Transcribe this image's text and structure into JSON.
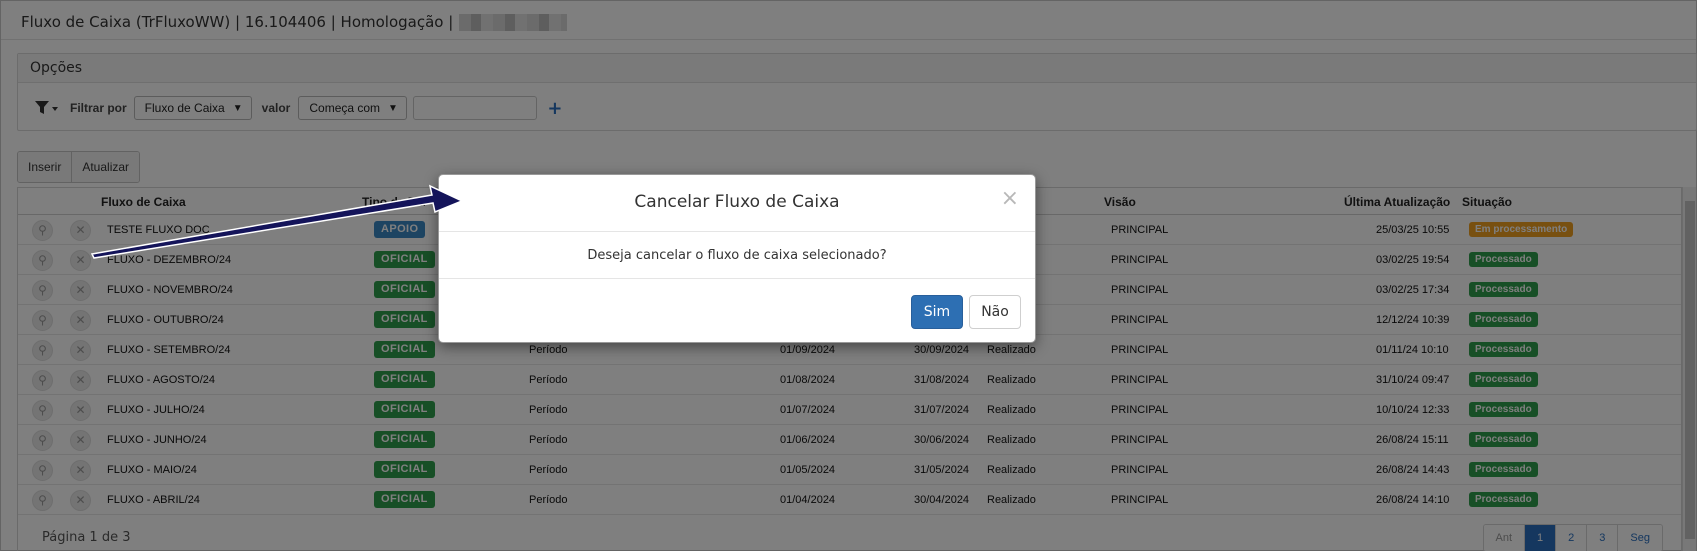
{
  "window": {
    "title": "Fluxo de Caixa (TrFluxoWW) | 16.104406 | Homologação |"
  },
  "options": {
    "header": "Opções",
    "filter_label": "Filtrar por",
    "filter_field": "Fluxo de Caixa",
    "value_label": "valor",
    "value_operator": "Começa com",
    "value_input": "",
    "add_icon": "plus-icon"
  },
  "toolbar": {
    "insert_label": "Inserir",
    "refresh_label": "Atualizar"
  },
  "grid": {
    "columns": {
      "fluxo": "Fluxo de Caixa",
      "tipo": "Tipo de Flu",
      "visao": "Visão",
      "ultima": "Última Atualização",
      "situacao": "Situação"
    },
    "rows": [
      {
        "name": "TESTE FLUXO DOC",
        "tipo": "APOIO",
        "periodo": "",
        "inicio": "",
        "fim": "",
        "realizado": "",
        "visao": "PRINCIPAL",
        "ultima": "25/03/25 10:55",
        "situacao": "Em processamento"
      },
      {
        "name": "FLUXO - DEZEMBRO/24",
        "tipo": "OFICIAL",
        "periodo": "",
        "inicio": "",
        "fim": "",
        "realizado": "",
        "visao": "PRINCIPAL",
        "ultima": "03/02/25 19:54",
        "situacao": "Processado"
      },
      {
        "name": "FLUXO - NOVEMBRO/24",
        "tipo": "OFICIAL",
        "periodo": "",
        "inicio": "",
        "fim": "",
        "realizado": "",
        "visao": "PRINCIPAL",
        "ultima": "03/02/25 17:34",
        "situacao": "Processado"
      },
      {
        "name": "FLUXO - OUTUBRO/24",
        "tipo": "OFICIAL",
        "periodo": "",
        "inicio": "",
        "fim": "",
        "realizado": "",
        "visao": "PRINCIPAL",
        "ultima": "12/12/24 10:39",
        "situacao": "Processado"
      },
      {
        "name": "FLUXO - SETEMBRO/24",
        "tipo": "OFICIAL",
        "periodo": "Período",
        "inicio": "01/09/2024",
        "fim": "30/09/2024",
        "realizado": "Realizado",
        "visao": "PRINCIPAL",
        "ultima": "01/11/24 10:10",
        "situacao": "Processado"
      },
      {
        "name": "FLUXO - AGOSTO/24",
        "tipo": "OFICIAL",
        "periodo": "Período",
        "inicio": "01/08/2024",
        "fim": "31/08/2024",
        "realizado": "Realizado",
        "visao": "PRINCIPAL",
        "ultima": "31/10/24 09:47",
        "situacao": "Processado"
      },
      {
        "name": "FLUXO - JULHO/24",
        "tipo": "OFICIAL",
        "periodo": "Período",
        "inicio": "01/07/2024",
        "fim": "31/07/2024",
        "realizado": "Realizado",
        "visao": "PRINCIPAL",
        "ultima": "10/10/24 12:33",
        "situacao": "Processado"
      },
      {
        "name": "FLUXO - JUNHO/24",
        "tipo": "OFICIAL",
        "periodo": "Período",
        "inicio": "01/06/2024",
        "fim": "30/06/2024",
        "realizado": "Realizado",
        "visao": "PRINCIPAL",
        "ultima": "26/08/24 15:11",
        "situacao": "Processado"
      },
      {
        "name": "FLUXO - MAIO/24",
        "tipo": "OFICIAL",
        "periodo": "Período",
        "inicio": "01/05/2024",
        "fim": "31/05/2024",
        "realizado": "Realizado",
        "visao": "PRINCIPAL",
        "ultima": "26/08/24 14:43",
        "situacao": "Processado"
      },
      {
        "name": "FLUXO - ABRIL/24",
        "tipo": "OFICIAL",
        "periodo": "Período",
        "inicio": "01/04/2024",
        "fim": "30/04/2024",
        "realizado": "Realizado",
        "visao": "PRINCIPAL",
        "ultima": "26/08/24 14:10",
        "situacao": "Processado"
      }
    ],
    "row_icons": [
      "search-icon",
      "close-icon"
    ]
  },
  "pagination": {
    "info": "Página 1 de 3",
    "prev": "Ant",
    "pages": [
      "1",
      "2",
      "3"
    ],
    "active_page": "1",
    "next": "Seg"
  },
  "modal": {
    "title": "Cancelar Fluxo de Caixa",
    "close": "×",
    "message": "Deseja cancelar o fluxo de caixa selecionado?",
    "confirm_label": "Sim",
    "cancel_label": "Não"
  },
  "colors": {
    "primary": "#2d6fb3",
    "oficial_badge": "#2e9e4c",
    "apoio_badge": "#3b88c4",
    "processado": "#2e9e4c",
    "em_processamento": "#f0a020",
    "annotation_arrow": "#14145a"
  }
}
